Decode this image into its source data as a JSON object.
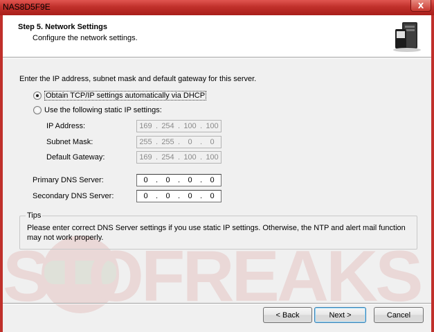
{
  "window": {
    "title": "NAS8D5F9E",
    "close_label": "X"
  },
  "header": {
    "step_title": "Step 5. Network Settings",
    "step_subtitle": "Configure the network settings."
  },
  "intro": "Enter the IP address, subnet mask and default gateway for this server.",
  "options": {
    "dhcp_label": "Obtain TCP/IP settings automatically via DHCP",
    "dhcp_selected": true,
    "static_label": "Use the following static IP settings:",
    "static_selected": false
  },
  "static": {
    "ip_label": "IP Address:",
    "ip": [
      "169",
      "254",
      "100",
      "100"
    ],
    "subnet_label": "Subnet Mask:",
    "subnet": [
      "255",
      "255",
      "0",
      "0"
    ],
    "gateway_label": "Default Gateway:",
    "gateway": [
      "169",
      "254",
      "100",
      "100"
    ]
  },
  "dns": {
    "primary_label": "Primary DNS Server:",
    "primary": [
      "0",
      "0",
      "0",
      "0"
    ],
    "secondary_label": "Secondary DNS Server:",
    "secondary": [
      "0",
      "0",
      "0",
      "0"
    ]
  },
  "tips": {
    "title": "Tips",
    "text": "Please enter correct DNS Server settings if you use static IP settings.  Otherwise, the NTP and alert mail function may not work properly."
  },
  "watermark": {
    "text": "STOFREAKS"
  },
  "buttons": {
    "back": "< Back",
    "next": "Next >",
    "cancel": "Cancel"
  },
  "colors": {
    "frame": "#c0302b",
    "dialog_bg": "#f0f0f0",
    "default_button_border": "#3c7fb1"
  }
}
